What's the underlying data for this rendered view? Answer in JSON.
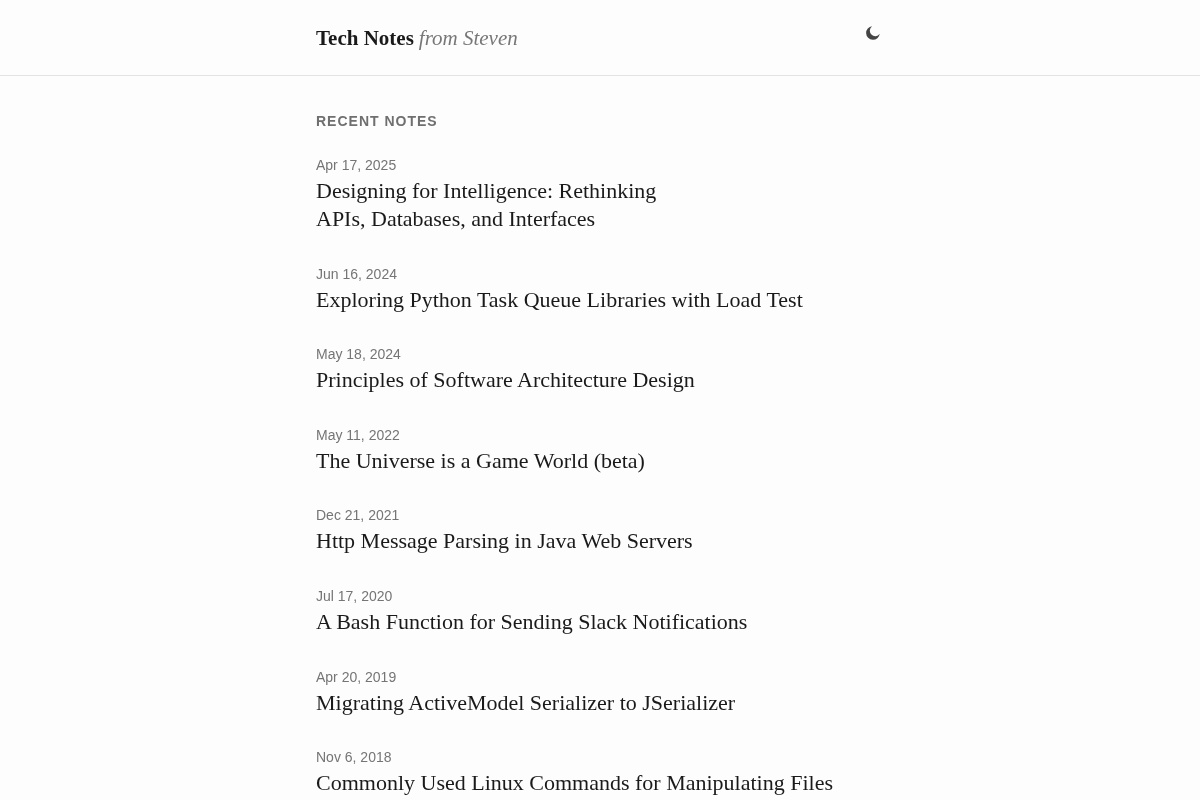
{
  "header": {
    "title": "Tech Notes",
    "subtitle": "from Steven"
  },
  "section": {
    "heading": "RECENT NOTES"
  },
  "notes": [
    {
      "date": "Apr 17, 2025",
      "title": "Designing for Intelligence: Rethinking\nAPIs, Databases, and Interfaces"
    },
    {
      "date": "Jun 16, 2024",
      "title": "Exploring Python Task Queue Libraries with Load Test"
    },
    {
      "date": "May 18, 2024",
      "title": "Principles of Software Architecture Design"
    },
    {
      "date": "May 11, 2022",
      "title": "The Universe is a Game World (beta)"
    },
    {
      "date": "Dec 21, 2021",
      "title": "Http Message Parsing in Java Web Servers"
    },
    {
      "date": "Jul 17, 2020",
      "title": "A Bash Function for Sending Slack Notifications"
    },
    {
      "date": "Apr 20, 2019",
      "title": "Migrating ActiveModel Serializer to JSerializer"
    },
    {
      "date": "Nov 6, 2018",
      "title": "Commonly Used Linux Commands for Manipulating Files"
    }
  ]
}
